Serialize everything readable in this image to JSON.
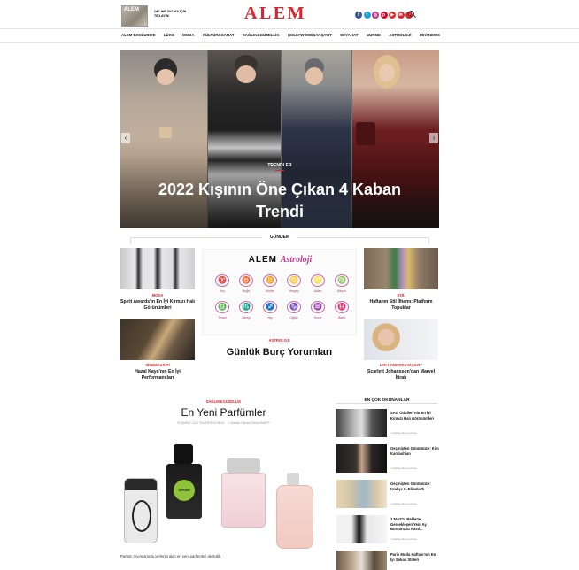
{
  "header": {
    "magazine_label": "ALEM",
    "promo_text": "ONLINE OKUMA İÇİN TIKLAYIN!",
    "logo": "ALEM",
    "social_icons": [
      {
        "name": "facebook-icon",
        "glyph": "f",
        "color": "#3b5998"
      },
      {
        "name": "twitter-icon",
        "glyph": "t",
        "color": "#1da1f2"
      },
      {
        "name": "instagram-icon",
        "glyph": "◎",
        "color": "#c13584"
      },
      {
        "name": "pinterest-icon",
        "glyph": "p",
        "color": "#e60023"
      },
      {
        "name": "youtube-icon",
        "glyph": "▶",
        "color": "#e52d27"
      },
      {
        "name": "mail-icon",
        "glyph": "✉",
        "color": "#e1222a"
      },
      {
        "name": "rss-icon",
        "glyph": "•",
        "color": "#e1222a"
      }
    ]
  },
  "nav": [
    "ALEM EXCLUSIVE",
    "LÜKS",
    "MODA",
    "KÜLTÜR&SANAT",
    "SAĞLIK&GÜZELLİK",
    "HOLLYWOOD&YAŞAYIT",
    "SEYAHAT",
    "GURME",
    "ASTROLOJİ",
    "DİKİ NEWS"
  ],
  "hero": {
    "category": "TRENDLER",
    "title": "2022 Kışının Öne Çıkan 4 Kaban Trendi",
    "prev": "‹",
    "next": "›"
  },
  "gundem": {
    "title": "GÜNDEM",
    "left_cards": [
      {
        "category": "MODA",
        "title": "Spirit Awards'ın En İyi Kırmızı Halı Görünümleri"
      },
      {
        "category": "SİNEMA&DİZİ",
        "title": "Hazal Kaya'nın En İyi Performansları"
      }
    ],
    "right_cards": [
      {
        "category": "STİL",
        "title": "Haftanın Stil İlhamı: Platform Topuklar"
      },
      {
        "category": "HOLLYWOOD&YAŞAYIT",
        "title": "Scarlett Johansson'dan Marvel İtirafı"
      }
    ],
    "center": {
      "brand": "ALEM",
      "brand_script": "Astroloji",
      "category": "ASTROLOJİ",
      "title": "Günlük Burç Yorumları",
      "signs": [
        {
          "glyph": "♈",
          "label": "Koç"
        },
        {
          "glyph": "♉",
          "label": "Boğa"
        },
        {
          "glyph": "♊",
          "label": "İkizler"
        },
        {
          "glyph": "♋",
          "label": "Yengeç"
        },
        {
          "glyph": "♌",
          "label": "Aslan"
        },
        {
          "glyph": "♍",
          "label": "Başak"
        },
        {
          "glyph": "♎",
          "label": "Terazi"
        },
        {
          "glyph": "♏",
          "label": "Akrep"
        },
        {
          "glyph": "♐",
          "label": "Yay"
        },
        {
          "glyph": "♑",
          "label": "Oğlak"
        },
        {
          "glyph": "♒",
          "label": "Kova"
        },
        {
          "glyph": "♓",
          "label": "Balık"
        }
      ]
    }
  },
  "article": {
    "category": "SAĞLIK&GÜZELLİK",
    "title": "En Yeni Parfümler",
    "date": "09 ŞUBAT 2022 PAZARTESİ 08:04",
    "read": "1 Dakika Okuma Süresi 848PP",
    "summary": "Parfüm reyonlarında yerlerini alan en yeni parfümleri derledik.",
    "bottle_label": "OPIUM"
  },
  "most_read": {
    "title": "EN ÇOK OKUNANLAR",
    "items": [
      {
        "title": "SAG Ödülleri'nin En İyi Kırmızı Halı Görünümleri",
        "meta": "1 dakika okuma süresi"
      },
      {
        "title": "Geçmişten Günümüze: Kim Kardashian",
        "meta": "1 dakika okuma süresi"
      },
      {
        "title": "Geçmişten Günümüze: Kraliçe II. Elizabeth",
        "meta": "1 dakika okuma süresi"
      },
      {
        "title": "2 Mart'ta Bekle'te Gerçekleşen Yeni Ay Burcunuzu Nasıl...",
        "meta": "1 dakika okuma süresi"
      },
      {
        "title": "Paris Moda Haftası'nın En İyi Sokak Stilleri",
        "meta": "1 dakika okuma süresi"
      }
    ]
  }
}
